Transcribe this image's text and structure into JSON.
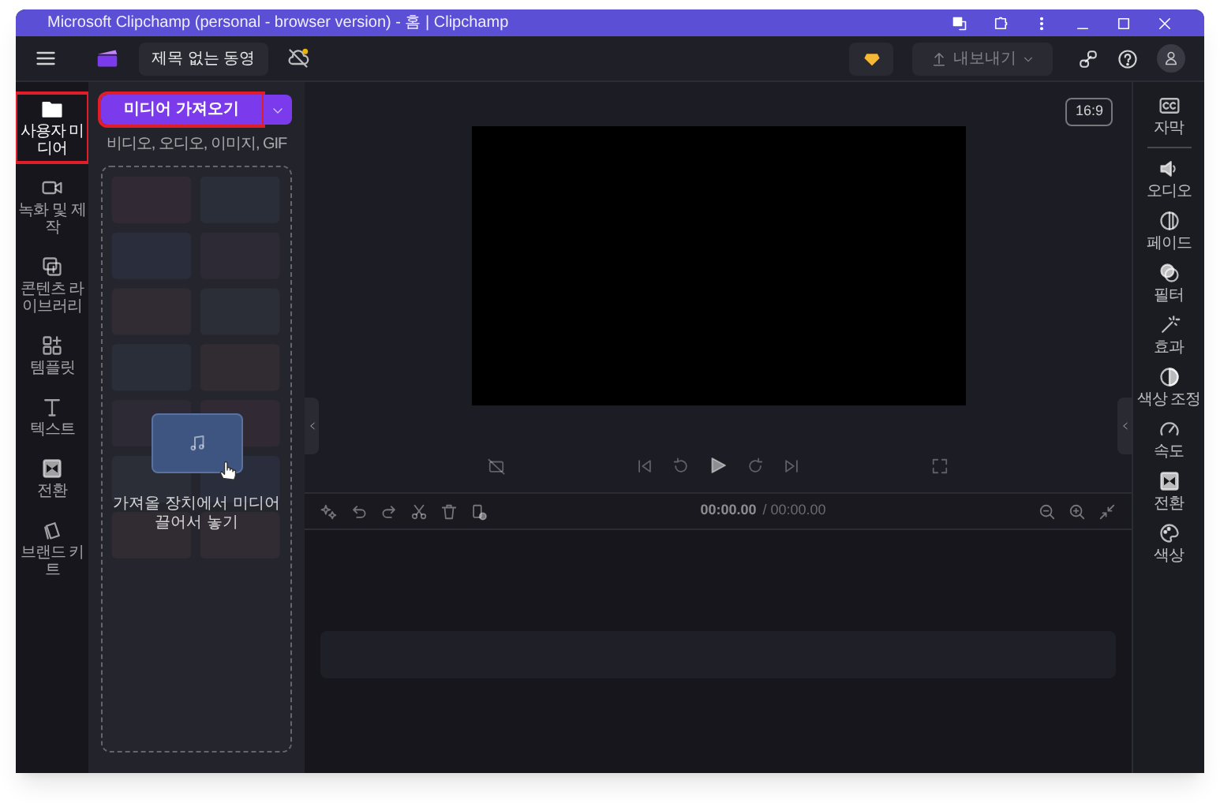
{
  "window": {
    "title": "Microsoft Clipchamp (personal - browser version) - 홈 | Clipchamp"
  },
  "toolbar": {
    "project_title": "제목 없는 동영",
    "export_button": "내보내기"
  },
  "nav": {
    "items": [
      {
        "label": "사용자 미디어",
        "kind": "folder",
        "selected": true
      },
      {
        "label": "녹화 및 제작",
        "kind": "camera",
        "selected": false
      },
      {
        "label": "콘텐츠 라이브러리",
        "kind": "library",
        "selected": false
      },
      {
        "label": "템플릿",
        "kind": "grid",
        "selected": false
      },
      {
        "label": "텍스트",
        "kind": "text",
        "selected": false
      },
      {
        "label": "전환",
        "kind": "transition",
        "selected": false
      },
      {
        "label": "브랜드 키트",
        "kind": "bag",
        "selected": false
      }
    ]
  },
  "media_panel": {
    "import_button": "미디어 가져오기",
    "formats": "비디오, 오디오, 이미지, GIF",
    "drop_hint": "가져올 장치에서 미디어 끌어서 놓기"
  },
  "preview": {
    "aspect_ratio": "16:9"
  },
  "timeline": {
    "current_time": "00:00.00",
    "total_time": "/ 00:00.00"
  },
  "properties": {
    "items": [
      {
        "label": "자막",
        "kind": "cc"
      },
      {
        "label": "오디오",
        "kind": "speaker"
      },
      {
        "label": "페이드",
        "kind": "fade"
      },
      {
        "label": "필터",
        "kind": "filter"
      },
      {
        "label": "효과",
        "kind": "wand"
      },
      {
        "label": "색상 조정",
        "kind": "contrast"
      },
      {
        "label": "속도",
        "kind": "gauge"
      },
      {
        "label": "전환",
        "kind": "transition"
      },
      {
        "label": "색상",
        "kind": "palette"
      }
    ]
  }
}
